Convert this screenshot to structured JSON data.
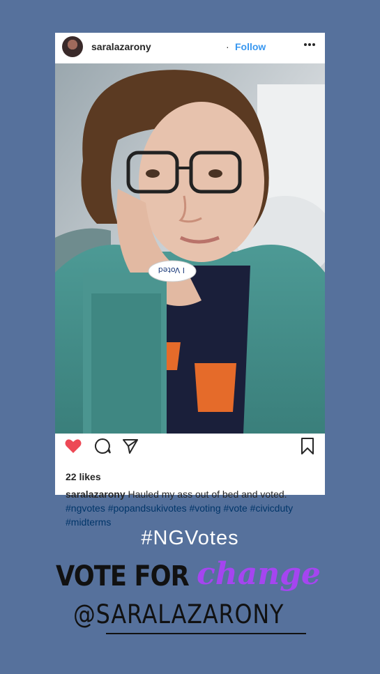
{
  "post": {
    "username": "saralazarony",
    "separator": "·",
    "follow_label": "Follow",
    "likes": "22 likes",
    "caption_user": "saralazarony",
    "caption_text": " Hauled my ass out of bed and voted. ",
    "hashtags": [
      "#ngvotes",
      "#popandsukivotes",
      "#voting",
      "#vote",
      "#civicduty",
      "#midterms"
    ],
    "sticker_text": "I Voted"
  },
  "story": {
    "hashtag": "#NGVotes",
    "vote_for": "VOTE FOR",
    "change": "change",
    "handle": "@SARALAZARONY"
  },
  "icons": {
    "more": "more-dots-icon",
    "like": "heart-icon",
    "comment": "comment-icon",
    "share": "share-icon",
    "save": "bookmark-icon"
  },
  "colors": {
    "background": "#56719c",
    "heart": "#ed4956",
    "link": "#3897f0",
    "hashtag": "#003569",
    "change": "#a545f0"
  }
}
